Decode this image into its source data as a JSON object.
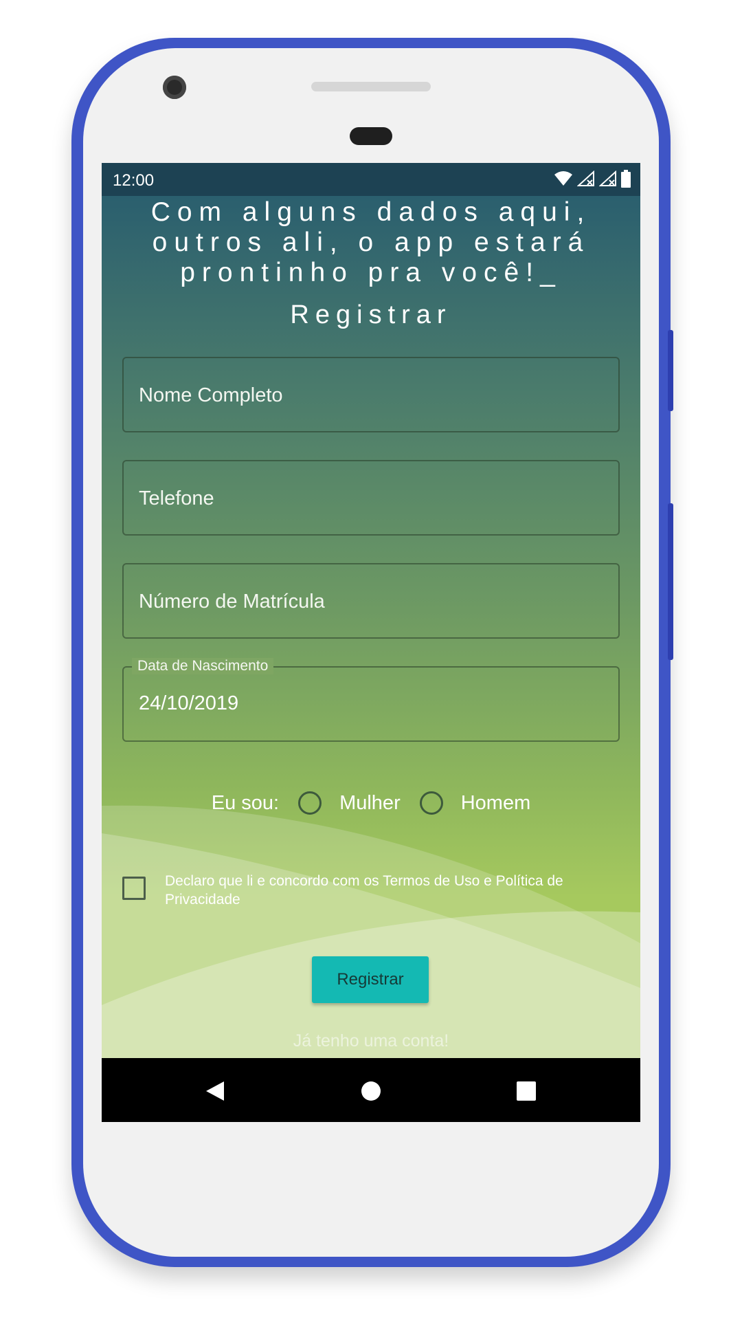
{
  "status_bar": {
    "time": "12:00",
    "icons": [
      "wifi-icon",
      "signal-icon",
      "signal-icon",
      "battery-icon"
    ]
  },
  "header": {
    "headline": "Com alguns dados aqui,\noutros ali, o app estará\nprontinho pra você!_",
    "section_title": "Registrar"
  },
  "form": {
    "full_name": {
      "placeholder": "Nome Completo",
      "value": ""
    },
    "phone": {
      "placeholder": "Telefone",
      "value": ""
    },
    "enrollment": {
      "placeholder": "Número de Matrícula",
      "value": ""
    },
    "birth_date": {
      "label": "Data de Nascimento",
      "value": "24/10/2019"
    },
    "gender": {
      "label": "Eu sou:",
      "options": [
        "Mulher",
        "Homem"
      ],
      "selected": null
    },
    "terms": {
      "checked": false,
      "text": "Declaro que li e concordo com os Termos de Uso e Política de Privacidade"
    },
    "submit_label": "Registrar",
    "login_link": "Já tenho uma conta!"
  },
  "colors": {
    "frame": "#3f55c6",
    "status_bar": "#1d4253",
    "gradient_top": "#255a6f",
    "gradient_bottom": "#a6c95e",
    "button": "#14b9b3"
  },
  "nav": {
    "icons": [
      "back-icon",
      "home-icon",
      "recents-icon"
    ]
  }
}
